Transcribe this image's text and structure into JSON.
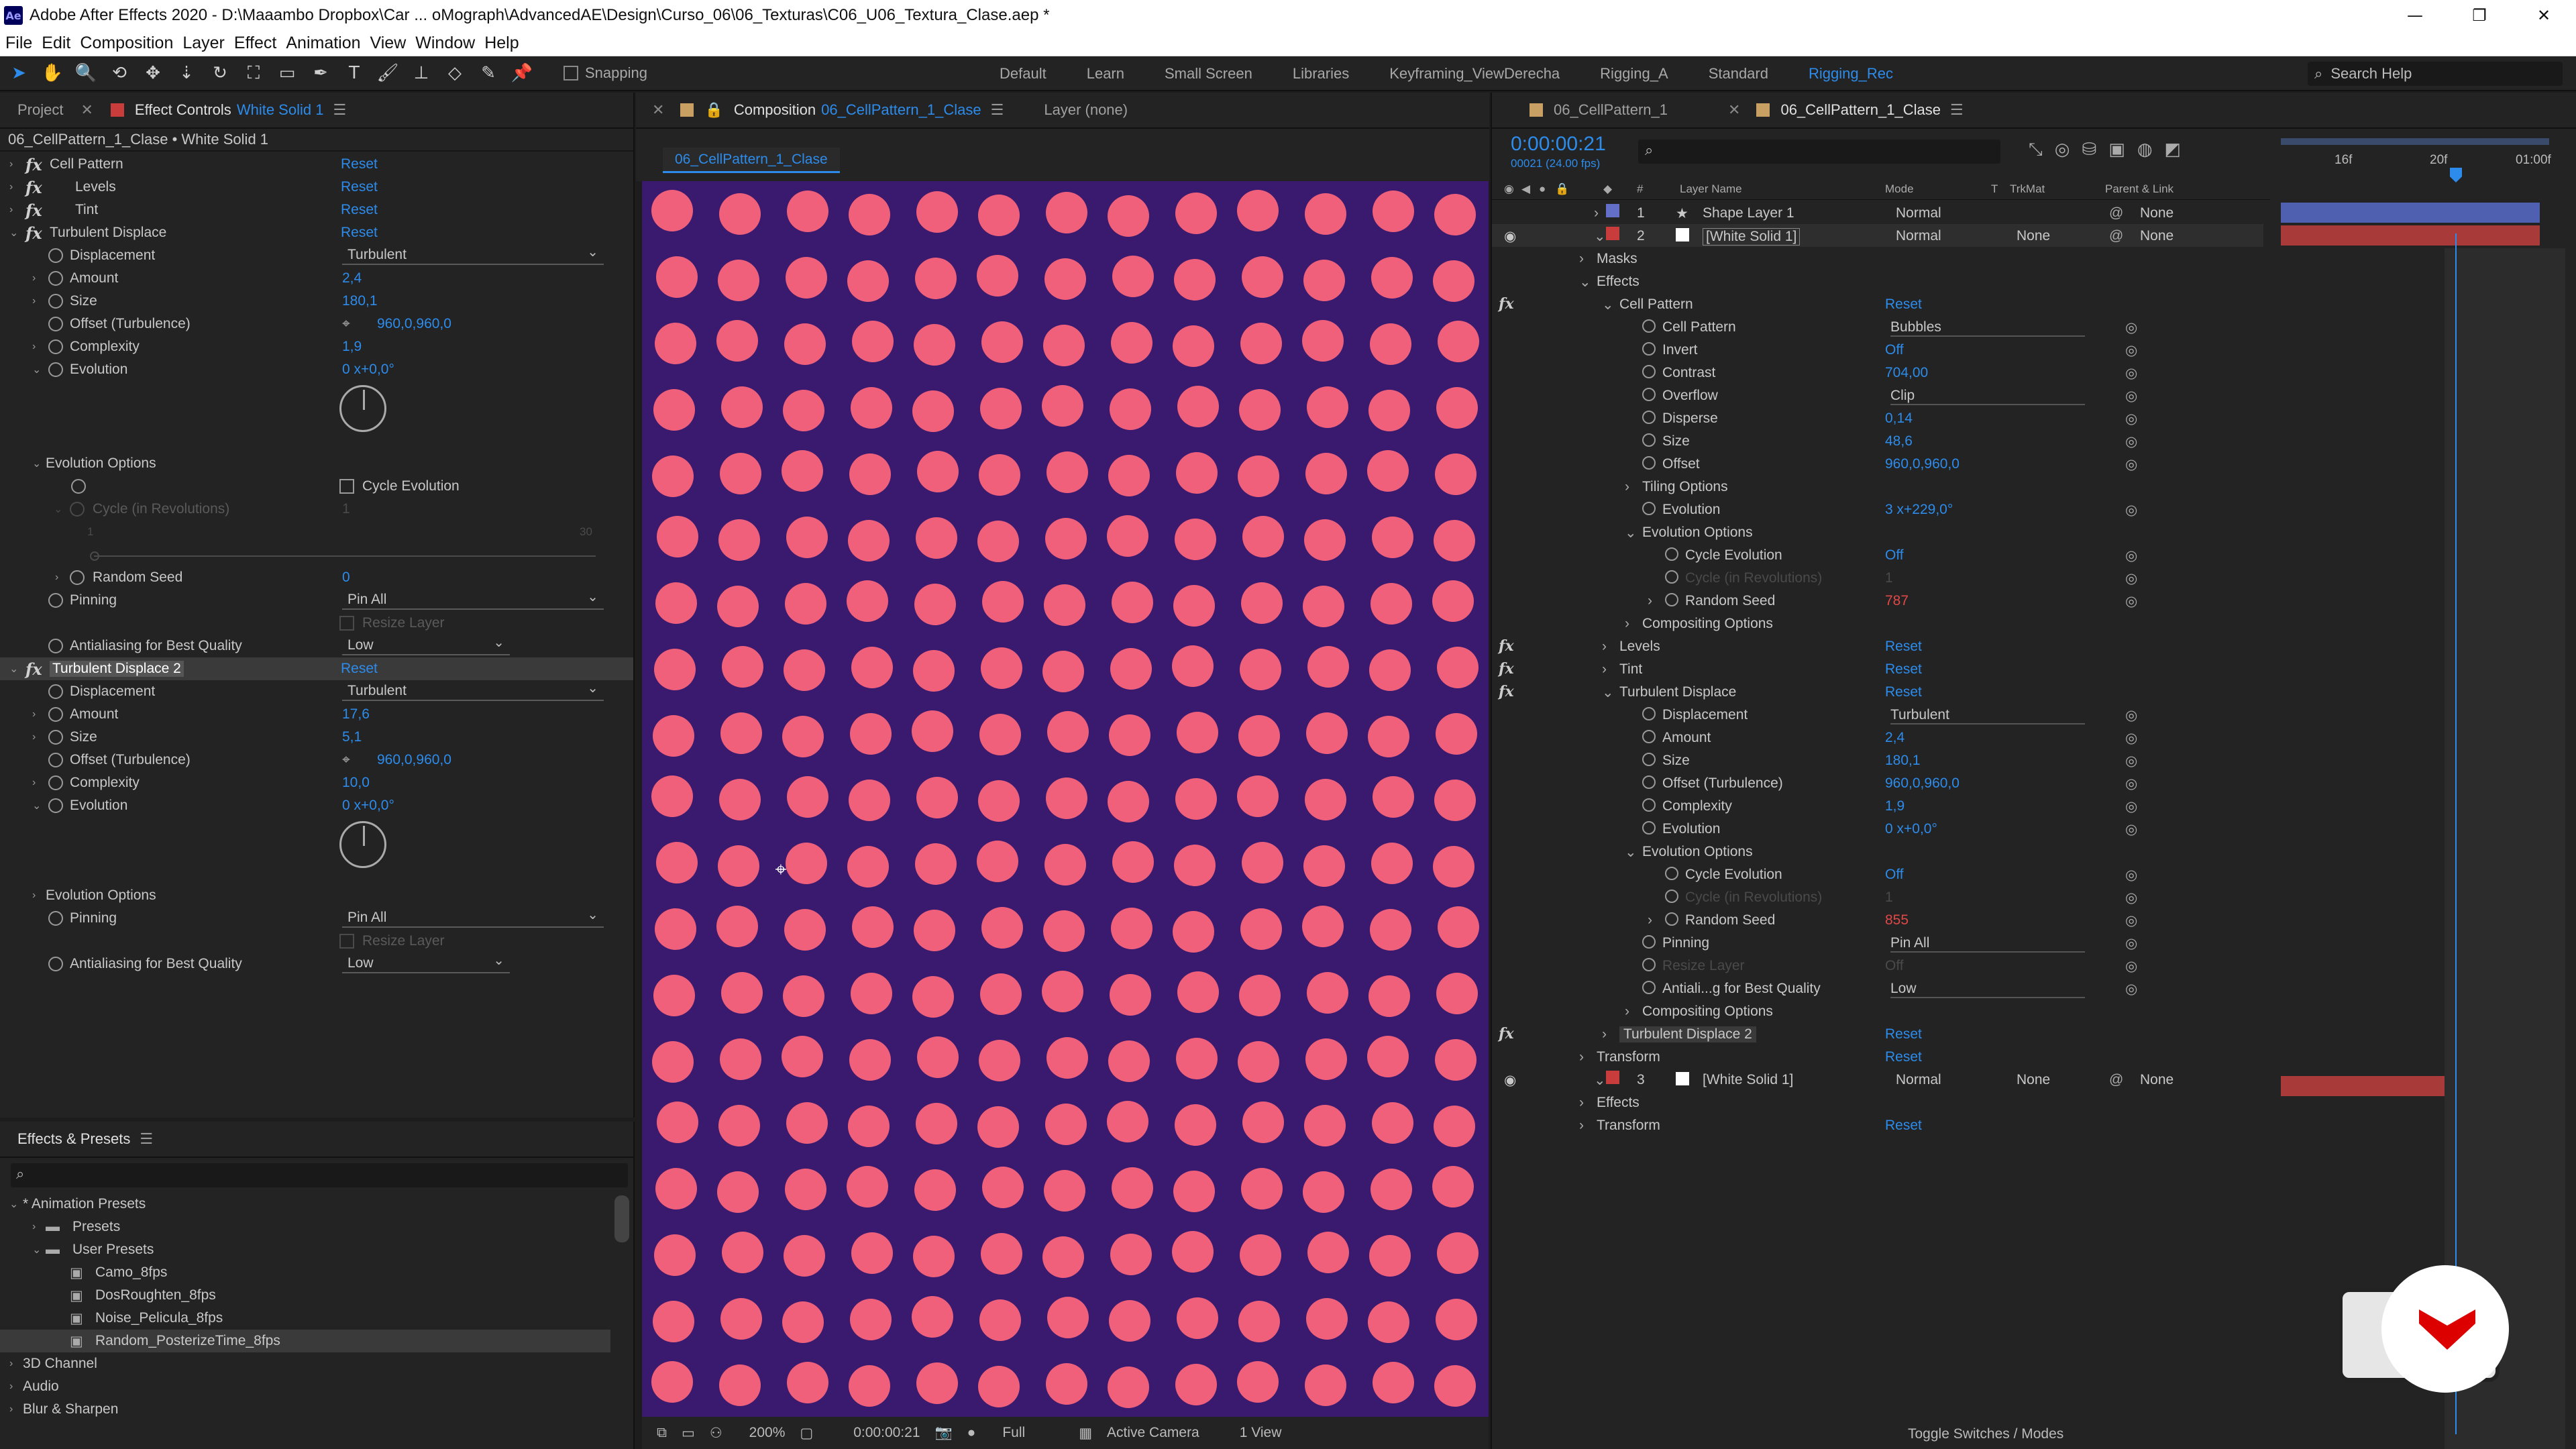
{
  "window": {
    "title": "Adobe After Effects 2020 - D:\\Maaambo Dropbox\\Car ... oMograph\\AdvancedAE\\Design\\Curso_06\\06_Texturas\\C06_U06_Textura_Clase.aep *",
    "app_icon": "Ae",
    "controls": [
      "—",
      "❐",
      "✕"
    ]
  },
  "menu": [
    "File",
    "Edit",
    "Composition",
    "Layer",
    "Effect",
    "Animation",
    "View",
    "Window",
    "Help"
  ],
  "toolbar": {
    "snapping_label": "Snapping",
    "workspaces": [
      "Default",
      "Learn",
      "Small Screen",
      "Libraries",
      "Keyframing_ViewDerecha",
      "Rigging_A",
      "Standard",
      "Rigging_Rec"
    ],
    "active_workspace": "Rigging_Rec",
    "search_placeholder": "Search Help",
    "accent": "#2d8ceb"
  },
  "left_panel": {
    "tabs": {
      "project": "Project",
      "effect_controls": "Effect Controls",
      "layer_name": "White Solid 1"
    },
    "header": "06_CellPattern_1_Clase • White Solid 1",
    "reset": "Reset",
    "effects": {
      "cell_pattern": "Cell Pattern",
      "levels": "Levels",
      "tint": "Tint",
      "turb1": {
        "name": "Turbulent Displace",
        "displacement_label": "Displacement",
        "displacement": "Turbulent",
        "amount_label": "Amount",
        "amount": "2,4",
        "size_label": "Size",
        "size": "180,1",
        "offset_label": "Offset (Turbulence)",
        "offset": "960,0,960,0",
        "complexity_label": "Complexity",
        "complexity": "1,9",
        "evolution_label": "Evolution",
        "evolution": "0 x+0,0°",
        "evo_options": "Evolution Options",
        "cycle_evolution": "Cycle Evolution",
        "cycle_revs": "Cycle (in Revolutions)",
        "cycle_revs_value": "1",
        "slider_min": "1",
        "slider_max": "30",
        "random_seed_label": "Random Seed",
        "random_seed": "0",
        "pinning_label": "Pinning",
        "pinning": "Pin All",
        "resize_layer": "Resize Layer",
        "aa_label": "Antialiasing for Best Quality",
        "aa": "Low"
      },
      "turb2": {
        "name": "Turbulent Displace 2",
        "displacement_label": "Displacement",
        "displacement": "Turbulent",
        "amount_label": "Amount",
        "amount": "17,6",
        "size_label": "Size",
        "size": "5,1",
        "offset_label": "Offset (Turbulence)",
        "offset": "960,0,960,0",
        "complexity_label": "Complexity",
        "complexity": "10,0",
        "evolution_label": "Evolution",
        "evolution": "0 x+0,0°",
        "evo_options": "Evolution Options",
        "pinning_label": "Pinning",
        "pinning": "Pin All",
        "resize_layer": "Resize Layer",
        "aa_label": "Antialiasing for Best Quality",
        "aa": "Low"
      }
    }
  },
  "effects_presets": {
    "title": "Effects & Presets",
    "search_placeholder": "",
    "tree": [
      "* Animation Presets",
      "Presets",
      "User Presets",
      "Camo_8fps",
      "DosRoughten_8fps",
      "Noise_Pelicula_8fps",
      "Random_PosterizeTime_8fps",
      "3D Channel",
      "Audio",
      "Blur & Sharpen"
    ]
  },
  "composition": {
    "tab_label": "Composition",
    "comp_name": "06_CellPattern_1_Clase",
    "layer_tab": "Layer  (none)",
    "sub_tab": "06_CellPattern_1_Clase",
    "bg_color": "#3a1a6e",
    "dot_color": "#f0607a",
    "dot_cols": 13,
    "dot_rows": 19,
    "bottom": {
      "zoom": "200%",
      "time": "0:00:00:21",
      "resolution": "Full",
      "camera": "Active Camera",
      "views": "1 View"
    }
  },
  "timeline": {
    "tabs": [
      "06_CellPattern_1",
      "06_CellPattern_1_Clase"
    ],
    "timecode": "0:00:00:21",
    "fps": "00021 (24.00 fps)",
    "ruler": [
      "16f",
      "20f",
      "01:00f"
    ],
    "columns": {
      "num": "#",
      "layer_name": "Layer Name",
      "mode": "Mode",
      "t": "T",
      "trkmat": "TrkMat",
      "parent": "Parent & Link"
    },
    "layers": [
      {
        "num": "1",
        "name": "Shape Layer 1",
        "mode": "Normal",
        "parent": "None"
      },
      {
        "num": "2",
        "name": "[White Solid 1]",
        "mode": "Normal",
        "trkmat": "None",
        "parent": "None"
      },
      {
        "num": "3",
        "name": "[White Solid 1]",
        "mode": "Normal",
        "trkmat": "None",
        "parent": "None"
      }
    ],
    "tree": {
      "masks": "Masks",
      "effects": "Effects",
      "cell_pattern": "Cell Pattern",
      "reset": "Reset",
      "cp_cell_pattern": "Cell Pattern",
      "cp_cell_pattern_v": "Bubbles",
      "cp_invert": "Invert",
      "cp_invert_v": "Off",
      "cp_contrast": "Contrast",
      "cp_contrast_v": "704,00",
      "cp_overflow": "Overflow",
      "cp_overflow_v": "Clip",
      "cp_disperse": "Disperse",
      "cp_disperse_v": "0,14",
      "cp_size": "Size",
      "cp_size_v": "48,6",
      "cp_offset": "Offset",
      "cp_offset_v": "960,0,960,0",
      "cp_tiling": "Tiling Options",
      "cp_evolution": "Evolution",
      "cp_evolution_v": "3 x+229,0°",
      "cp_evo_options": "Evolution Options",
      "cp_cycle": "Cycle Evolution",
      "cp_cycle_v": "Off",
      "cp_cycle_revs": "Cycle (in Revolutions)",
      "cp_cycle_revs_v": "1",
      "cp_seed": "Random Seed",
      "cp_seed_v": "787",
      "compositing": "Compositing Options",
      "levels": "Levels",
      "tint": "Tint",
      "turb": "Turbulent Displace",
      "td_displacement": "Displacement",
      "td_displacement_v": "Turbulent",
      "td_amount": "Amount",
      "td_amount_v": "2,4",
      "td_size": "Size",
      "td_size_v": "180,1",
      "td_offset": "Offset (Turbulence)",
      "td_offset_v": "960,0,960,0",
      "td_complexity": "Complexity",
      "td_complexity_v": "1,9",
      "td_evolution": "Evolution",
      "td_evolution_v": "0 x+0,0°",
      "td_evo_options": "Evolution Options",
      "td_cycle": "Cycle Evolution",
      "td_cycle_v": "Off",
      "td_cycle_revs": "Cycle (in Revolutions)",
      "td_cycle_revs_v": "1",
      "td_seed": "Random Seed",
      "td_seed_v": "855",
      "td_pinning": "Pinning",
      "td_pinning_v": "Pin All",
      "td_resize": "Resize Layer",
      "td_resize_v": "Off",
      "td_aa": "Antiali...g for Best Quality",
      "td_aa_v": "Low",
      "compositing2": "Compositing Options",
      "turb2": "Turbulent Displace 2",
      "transform": "Transform",
      "l3_effects": "Effects",
      "l3_transform": "Transform"
    },
    "toggle_label": "Toggle Switches / Modes"
  }
}
